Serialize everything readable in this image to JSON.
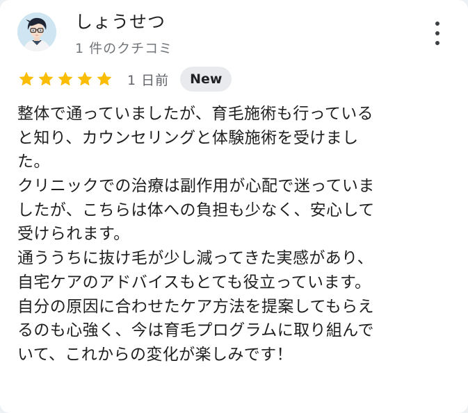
{
  "reviewer": {
    "name": "しょうせつ",
    "review_count": "1 件のクチコミ"
  },
  "rating": {
    "stars": 5,
    "max_stars": 5,
    "star_color": "#fbbc04",
    "date": "1 日前",
    "badge": "New"
  },
  "review": {
    "lines": [
      "整体で通っていましたが、育毛施術も行っている",
      "と知り、カウンセリングと体験施術を受けまし",
      "た。",
      "クリニックでの治療は副作用が心配で迷っていま",
      "したが、こちらは体への負担も少なく、安心して",
      "受けられます。",
      "通ううちに抜け毛が少し減ってきた実感があり、",
      "自宅ケアのアドバイスもとても役立っています。",
      "自分の原因に合わせたケア方法を提案してもらえ",
      "るのも心強く、今は育毛プログラムに取り組んで",
      "いて、これからの変化が楽しみです！"
    ]
  },
  "icons": {
    "avatar": "avatar-illustration",
    "more": "more-vert-icon",
    "star": "star-icon"
  }
}
